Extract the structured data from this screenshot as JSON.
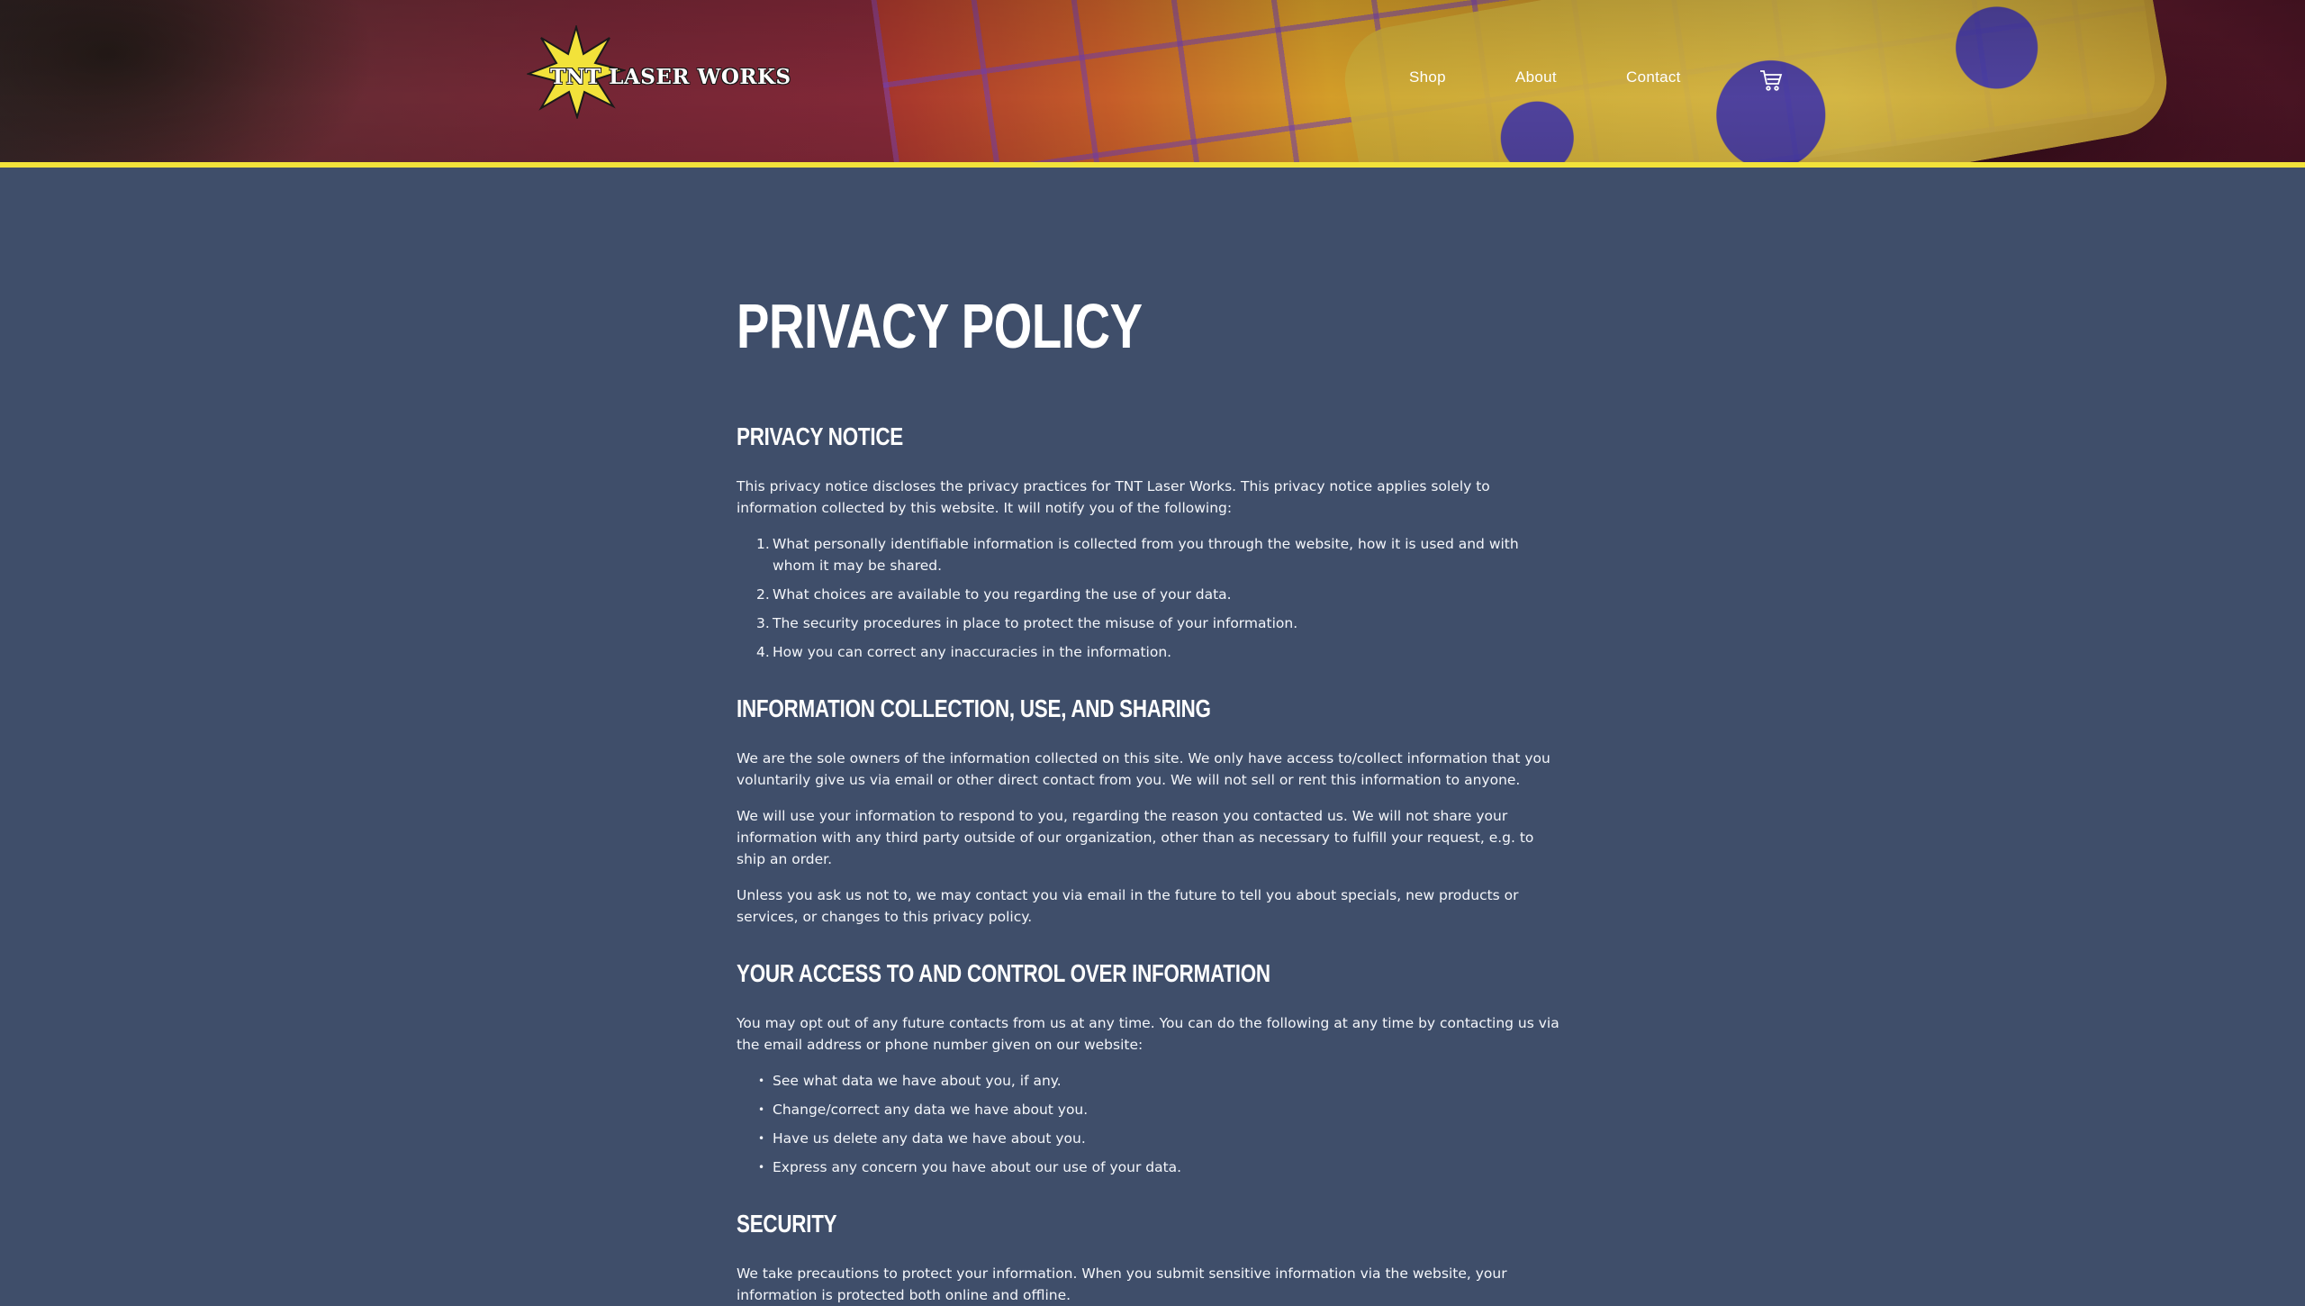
{
  "brand": {
    "name": "TNT LASER WORKS",
    "star_color": "#f2e23a"
  },
  "nav": {
    "items": [
      "Shop",
      "About",
      "Contact"
    ],
    "cart_icon": "cart-icon"
  },
  "colors": {
    "background": "#3f4e6a",
    "accent": "#f2e23a",
    "text": "#ffffff"
  },
  "page": {
    "title": "PRIVACY POLICY",
    "sections": {
      "notice": {
        "heading": "PRIVACY NOTICE",
        "intro": "This privacy notice discloses the privacy practices for TNT Laser Works. This privacy notice applies solely to information collected by this website. It will notify you of the following:",
        "items": [
          "What personally identifiable information is collected from you through the website, how it is used and with whom it may be shared.",
          "What choices are available to you regarding the use of your data.",
          "The security procedures in place to protect the misuse of your information.",
          "How you can correct any inaccuracies in the information."
        ]
      },
      "collection": {
        "heading": "INFORMATION COLLECTION, USE, AND SHARING",
        "paragraphs": [
          "We are the sole owners of the information collected on this site. We only have access to/collect information that you voluntarily give us via email or other direct contact from you. We will not sell or rent this information to anyone.",
          "We will use your information to respond to you, regarding the reason you contacted us. We will not share your information with any third party outside of our organization, other than as necessary to fulfill your request, e.g. to ship an order.",
          "Unless you ask us not to, we may contact you via email in the future to tell you about specials, new products or services, or changes to this privacy policy."
        ]
      },
      "access": {
        "heading": "YOUR ACCESS TO AND CONTROL OVER INFORMATION",
        "intro": "You may opt out of any future contacts from us at any time. You can do the following at any time by contacting us via the email address or phone number given on our website:",
        "items": [
          "See what data we have about you, if any.",
          "Change/correct any data we have about you.",
          "Have us delete any data we have about you.",
          "Express any concern you have about our use of your data."
        ]
      },
      "security": {
        "heading": "SECURITY",
        "intro": "We take precautions to protect your information. When you submit sensitive information via the website, your information is protected both online and offline."
      }
    }
  }
}
